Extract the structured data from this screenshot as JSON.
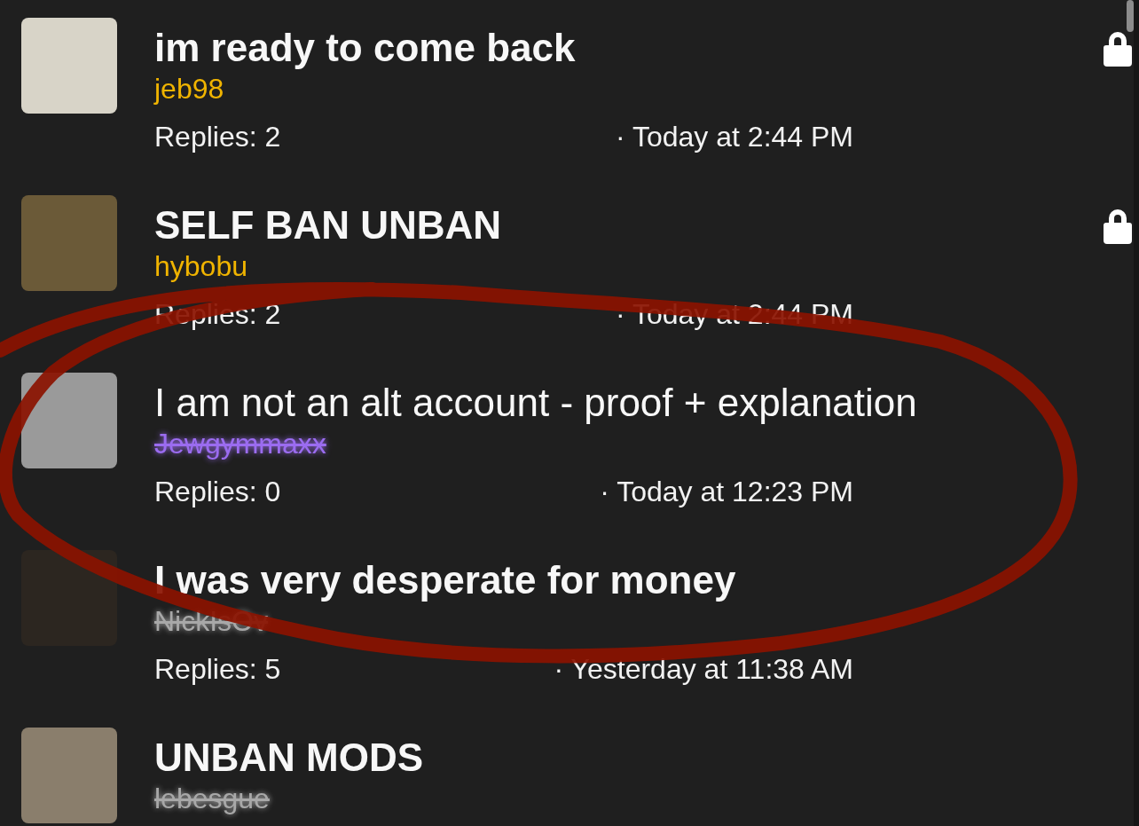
{
  "threads": [
    {
      "title": "im ready to come back",
      "unread": true,
      "author": "jeb98",
      "author_banned": false,
      "color": "#f0b400",
      "replies": "Replies: 2",
      "time": "· Today at 2:44 PM",
      "locked": true
    },
    {
      "title": "SELF BAN UNBAN",
      "unread": true,
      "author": "hybobu",
      "author_banned": false,
      "color": "#f0b400",
      "replies": "Replies: 2",
      "time": "· Today at 2:44 PM",
      "locked": true
    },
    {
      "title": "I am not an alt account - proof + explanation",
      "unread": false,
      "author": "Jewgymmaxx",
      "author_banned": true,
      "color": "#9b6cf0",
      "replies": "Replies: 0",
      "time": "· Today at 12:23 PM",
      "locked": false
    },
    {
      "title": "I was very desperate for money",
      "unread": true,
      "author": "NickIsOv",
      "author_banned": true,
      "color": "#a8a8a8",
      "replies": "Replies: 5",
      "time": "· Yesterday at 11:38 AM",
      "locked": false
    },
    {
      "title": "UNBAN MODS",
      "unread": true,
      "author": "lebesgue",
      "author_banned": true,
      "color": "#a8a8a8",
      "locked": false
    }
  ]
}
